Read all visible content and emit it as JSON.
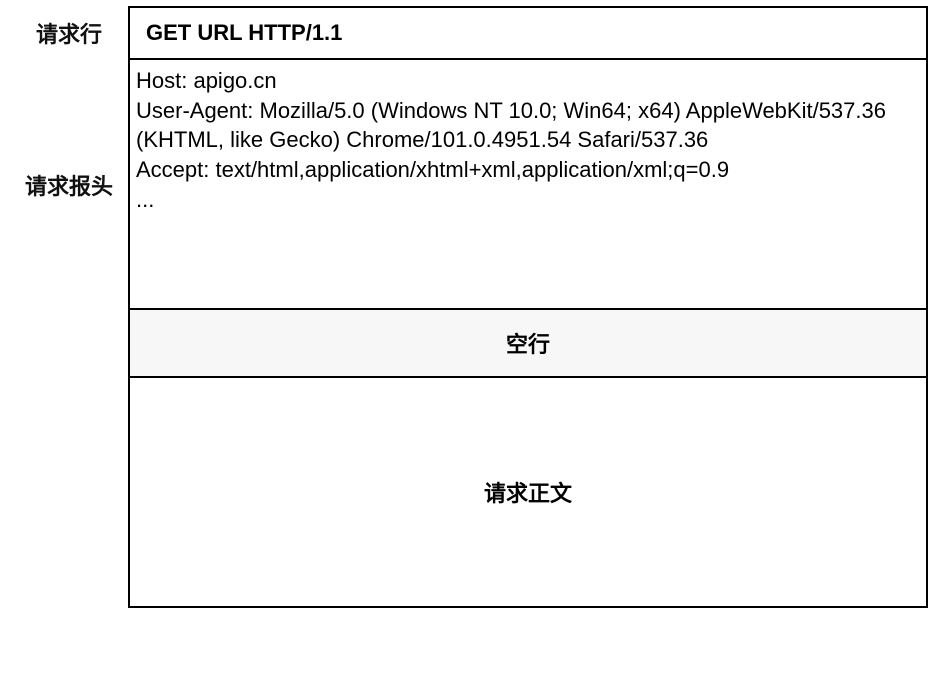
{
  "labels": {
    "request_line": "请求行",
    "request_headers": "请求报头"
  },
  "boxes": {
    "request_line": "GET URL HTTP/1.1",
    "request_headers": "Host: apigo.cn\nUser-Agent: Mozilla/5.0 (Windows NT 10.0; Win64; x64) AppleWebKit/537.36 (KHTML, like Gecko) Chrome/101.0.4951.54 Safari/537.36\nAccept: text/html,application/xhtml+xml,application/xml;q=0.9\n...",
    "empty_line": "空行",
    "body": "请求正文"
  }
}
